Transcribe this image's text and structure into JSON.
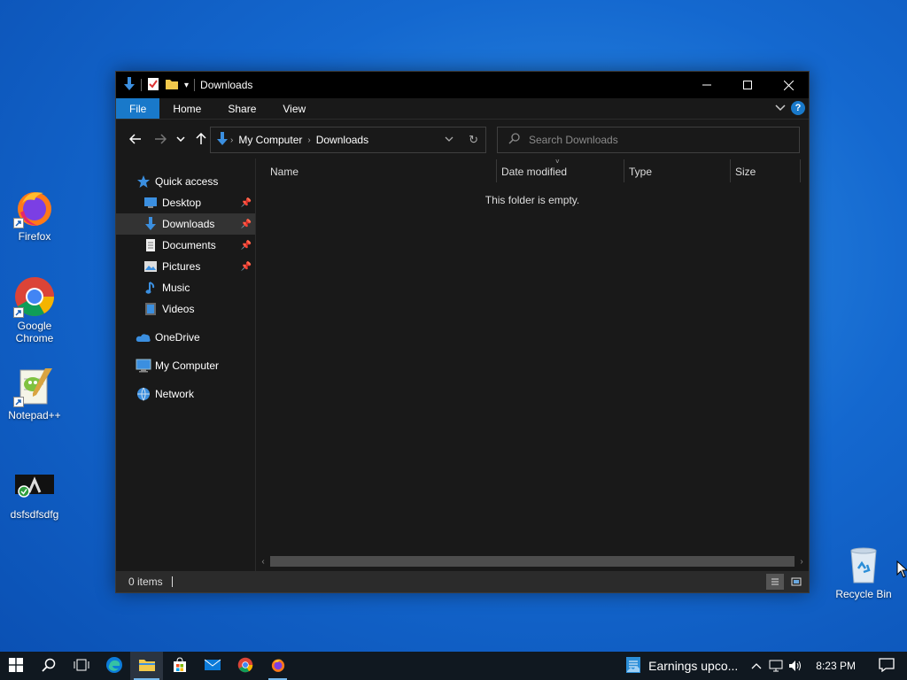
{
  "desktop": {
    "icons": [
      {
        "label": "Firefox",
        "icon": "firefox-icon"
      },
      {
        "label": "Google Chrome",
        "icon": "chrome-icon"
      },
      {
        "label": "Notepad++",
        "icon": "notepadpp-icon"
      },
      {
        "label": "dsfsdfsdfg",
        "icon": "app-icon"
      },
      {
        "label": "Recycle Bin",
        "icon": "recycle-bin-icon"
      }
    ]
  },
  "window": {
    "title": "Downloads",
    "ribbon_tabs": [
      "File",
      "Home",
      "Share",
      "View"
    ],
    "address": {
      "crumbs": [
        "My Computer",
        "Downloads"
      ]
    },
    "search": {
      "placeholder": "Search Downloads",
      "value": ""
    },
    "nav": {
      "quick_access": "Quick access",
      "items": [
        {
          "label": "Desktop",
          "pinned": true
        },
        {
          "label": "Downloads",
          "pinned": true,
          "selected": true
        },
        {
          "label": "Documents",
          "pinned": true
        },
        {
          "label": "Pictures",
          "pinned": true
        },
        {
          "label": "Music",
          "pinned": false
        },
        {
          "label": "Videos",
          "pinned": false
        }
      ],
      "onedrive": "OneDrive",
      "my_computer": "My Computer",
      "network": "Network"
    },
    "columns": [
      "Name",
      "Date modified",
      "Type",
      "Size"
    ],
    "empty_message": "This folder is empty.",
    "status": "0 items"
  },
  "taskbar": {
    "news": "Earnings upco...",
    "time": "8:23 PM"
  },
  "colors": {
    "accent": "#1979ca",
    "window_bg": "#191919",
    "desktop": "#1468cf"
  }
}
